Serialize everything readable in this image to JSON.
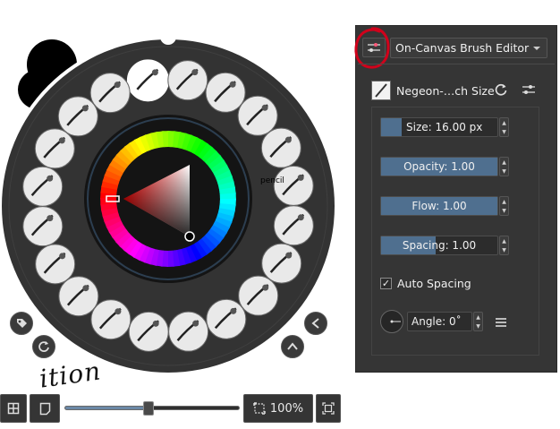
{
  "palette": {
    "brushes": [
      {
        "name": "brush-preset-1",
        "icon": "fill-tool-icon"
      },
      {
        "name": "brush-preset-2",
        "icon": "ink-pen-icon"
      },
      {
        "name": "brush-preset-3",
        "icon": "ink-pen-icon"
      },
      {
        "name": "brush-preset-4",
        "icon": "basic-circle-icon"
      },
      {
        "name": "brush-preset-5",
        "icon": "pencil-icon"
      },
      {
        "name": "brush-preset-6",
        "icon": "marker-icon"
      },
      {
        "name": "brush-preset-7",
        "icon": "bristle-brush-icon"
      },
      {
        "name": "brush-preset-8",
        "icon": "airbrush-icon"
      },
      {
        "name": "brush-preset-9",
        "icon": "ink-brush-icon"
      },
      {
        "name": "brush-preset-10",
        "icon": "fountain-pen-icon"
      },
      {
        "name": "brush-preset-11",
        "icon": "pen-icon"
      },
      {
        "name": "brush-preset-12",
        "icon": "ink-pen-icon"
      },
      {
        "name": "brush-preset-13",
        "icon": "pencil-icon"
      },
      {
        "name": "brush-preset-14",
        "icon": "sketch-pen-icon"
      },
      {
        "name": "brush-preset-15",
        "icon": "ink-brush-icon"
      },
      {
        "name": "brush-preset-16",
        "icon": "fountain-pen-icon"
      },
      {
        "name": "brush-preset-17",
        "icon": "ink-pen-icon"
      },
      {
        "name": "brush-preset-18",
        "icon": "ink-pen-icon"
      },
      {
        "name": "brush-preset-19",
        "icon": "eraser-icon"
      },
      {
        "name": "brush-preset-20",
        "icon": "smudge-brush-icon"
      }
    ],
    "pencil_label": "pencil",
    "colors": {
      "foreground": "#000000",
      "background": "#ffffff",
      "accent": "#6b88a6"
    }
  },
  "toolbar": {
    "zoom_label": "100%",
    "zoom_fraction": 0.48,
    "canvas_text": "ition"
  },
  "editor": {
    "dropdown_label": "On-Canvas Brush Editor",
    "brush_name": "Negeon-…ch Size",
    "size_label": "Size: 16.00 px",
    "size_fraction": 0.18,
    "opacity_label": "Opacity: 1.00",
    "opacity_fraction": 1.0,
    "flow_label": "Flow: 1.00",
    "flow_fraction": 1.0,
    "spacing_label": "Spacing: 1.00",
    "spacing_fraction": 0.47,
    "auto_spacing_label": "Auto Spacing",
    "auto_spacing_checked": true,
    "angle_label": "Angle: 0˚",
    "highlight_color": "#d0021b"
  }
}
